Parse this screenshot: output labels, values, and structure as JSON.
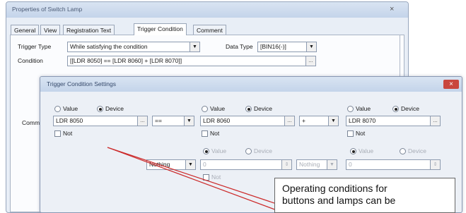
{
  "props_window": {
    "title": "Properties of Switch Lamp",
    "close": "×",
    "tabs": [
      "General",
      "View",
      "Registration Text",
      "Trigger Condition",
      "Comment"
    ],
    "trigger_type_label": "Trigger Type",
    "trigger_type_value": "While satisfying the condition",
    "data_type_label": "Data Type",
    "data_type_value": "[BIN16(-)]",
    "condition_label": "Condition",
    "condition_value": "[[LDR 8050] == [LDR 8060] + [LDR 8070]]",
    "comment_label": "Comm"
  },
  "dialog": {
    "title": "Trigger Condition Settings",
    "close": "×",
    "operand1": {
      "value_label": "Value",
      "device_label": "Device",
      "device_value": "LDR 8050",
      "not_label": "Not"
    },
    "operator1": "==",
    "operand2": {
      "value_label": "Value",
      "device_label": "Device",
      "device_value": "LDR 8060",
      "not_label": "Not",
      "sub_value_label": "Value",
      "sub_device_label": "Device",
      "sub_device_value": "0",
      "sub_not_label": "Not"
    },
    "operator2": "+",
    "operand3": {
      "value_label": "Value",
      "device_label": "Device",
      "device_value": "LDR 8070",
      "not_label": "Not",
      "sub_value_label": "Value",
      "sub_device_label": "Device",
      "sub_device_value": "0"
    },
    "row2_operator": "Nothing",
    "row2_operator2": "Nothing"
  },
  "callout": {
    "line1": "Operating conditions for",
    "line2": "buttons and lamps can be"
  }
}
